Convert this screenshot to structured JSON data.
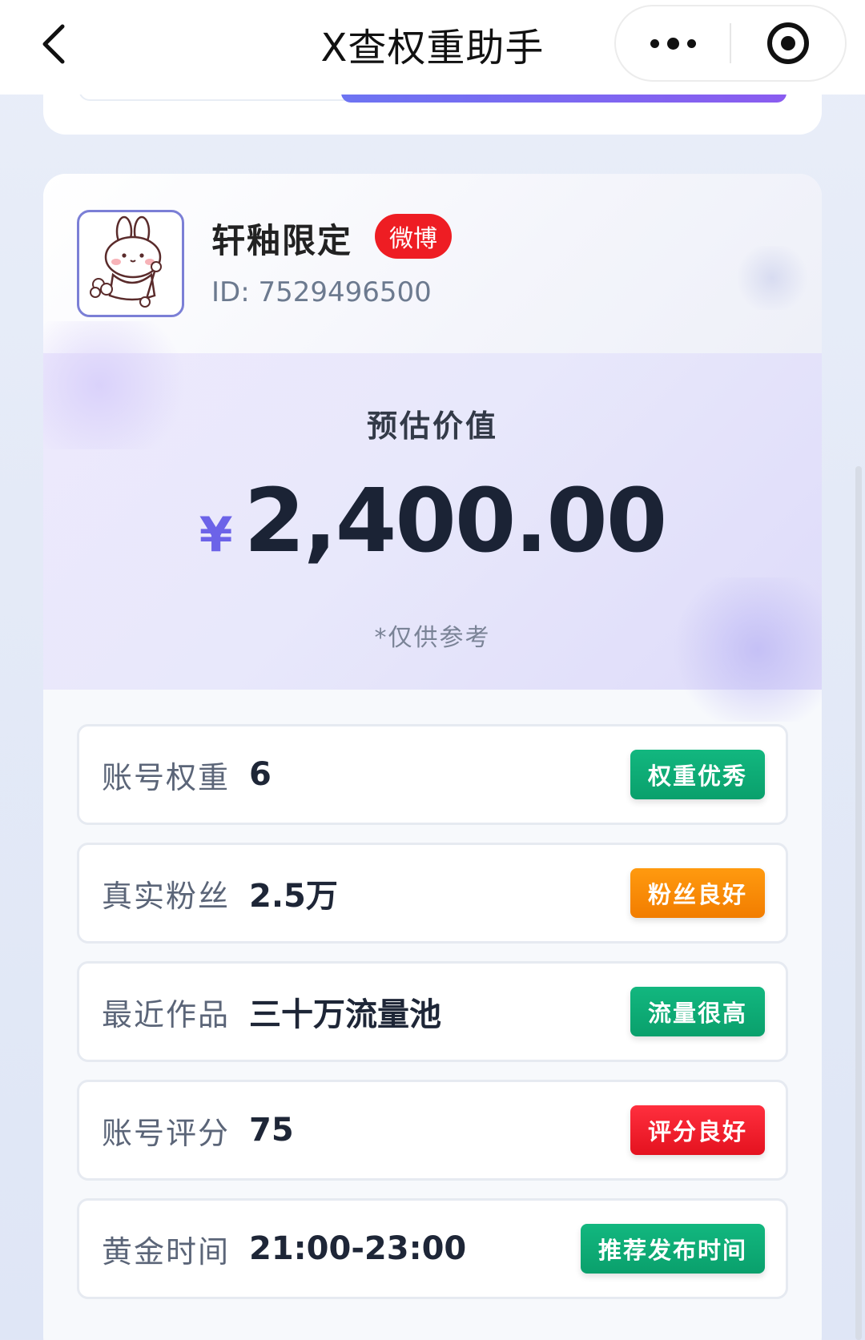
{
  "titlebar": {
    "title": "X查权重助手"
  },
  "profile": {
    "name": "轩釉限定",
    "platform": "微博",
    "id_text": "ID: 7529496500"
  },
  "valuation": {
    "label": "预估价值",
    "currency": "¥",
    "amount": "2,400.00",
    "disclaimer": "*仅供参考"
  },
  "metrics": [
    {
      "label": "账号权重",
      "value": "6",
      "tag": "权重优秀",
      "tag_color": "#0fae77"
    },
    {
      "label": "真实粉丝",
      "value": "2.5万",
      "tag": "粉丝良好",
      "tag_color": "#f88a06"
    },
    {
      "label": "最近作品",
      "value": "三十万流量池",
      "tag": "流量很高",
      "tag_color": "#0fae77"
    },
    {
      "label": "账号评分",
      "value": "75",
      "tag": "评分良好",
      "tag_color": "#ee1d23"
    },
    {
      "label": "黄金时间",
      "value": "21:00-23:00",
      "tag": "推荐发布时间",
      "tag_color": "#0fae77"
    }
  ],
  "icons": {
    "back": "chevron-left-icon",
    "more": "more-dots-icon",
    "close": "target-circle-icon",
    "avatar": "bunny-avatar"
  },
  "colors": {
    "accent": "#6c63e8",
    "platform_badge": "#ee1d23",
    "amount_text": "#1b2335"
  }
}
